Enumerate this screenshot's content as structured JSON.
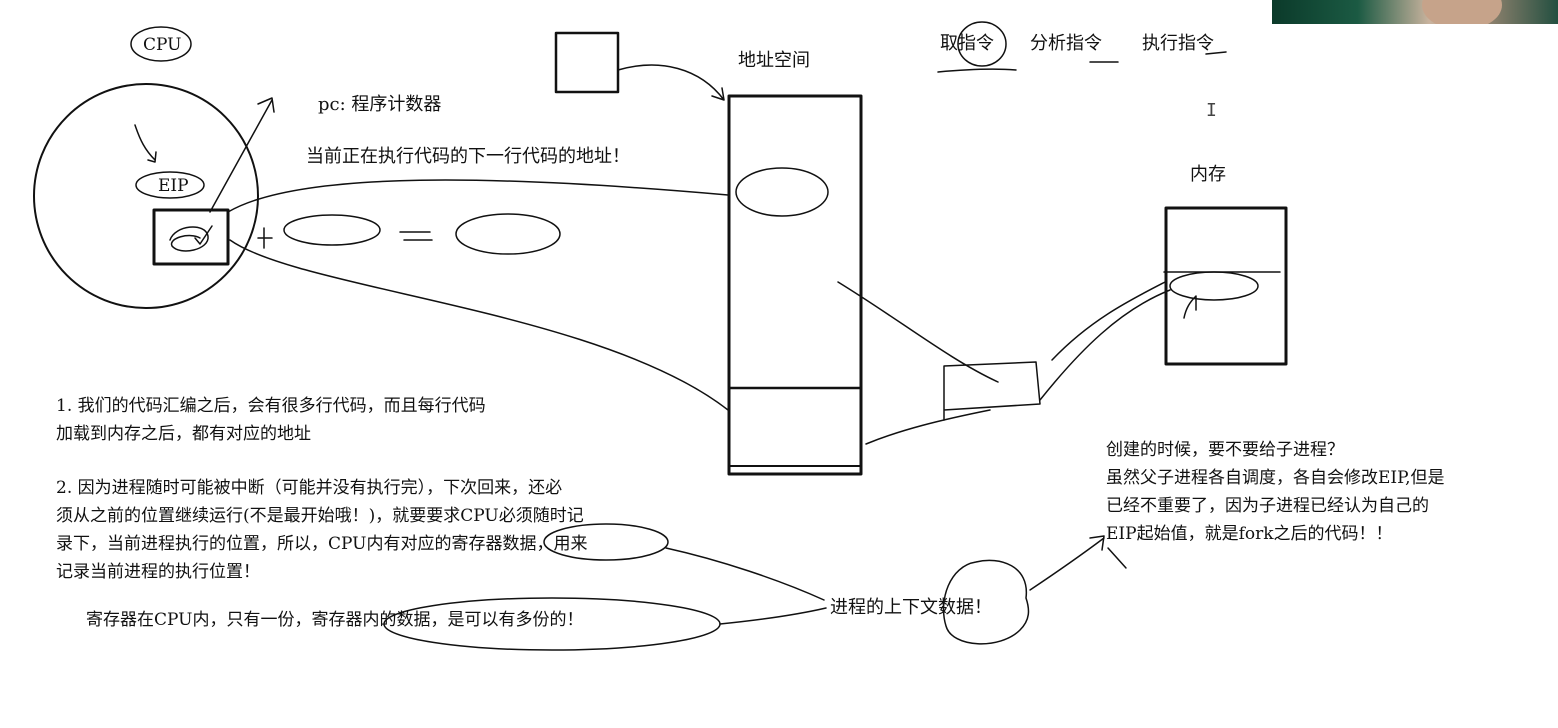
{
  "labels": {
    "cpu": "CPU",
    "eip": "EIP",
    "pc": "pc: 程序计数器",
    "next_addr": "当前正在执行代码的下一行代码的地址！",
    "address_space": "地址空间",
    "memory": "内存",
    "fetch": "取指令",
    "decode": "分析指令",
    "execute": "执行指令",
    "context": "进程的上下文数据！"
  },
  "notes": {
    "note1": [
      "1. 我们的代码汇编之后，会有很多行代码，而且每行代码",
      "加载到内存之后，都有对应的地址"
    ],
    "note2": [
      "2. 因为进程随时可能被中断（可能并没有执行完），下次回来，还必",
      "须从之前的位置继续运行(不是最开始哦！)，就要要求CPU必须随时记",
      "录下，当前进程执行的位置，所以，CPU内有对应的寄存器数据，用来",
      "记录当前进程的执行位置！"
    ],
    "note3": "寄存器在CPU内，只有一份，寄存器内的数据，是可以有多份的！",
    "fork": [
      "创建的时候，要不要给子进程？",
      "虽然父子进程各自调度，各自会修改EIP,但是",
      "已经不重要了，因为子进程已经认为自己的",
      "EIP起始值，就是fork之后的代码！！"
    ]
  },
  "cursor_glyph": "I",
  "colors": {
    "ink": "#111111",
    "background": "#ffffff"
  }
}
